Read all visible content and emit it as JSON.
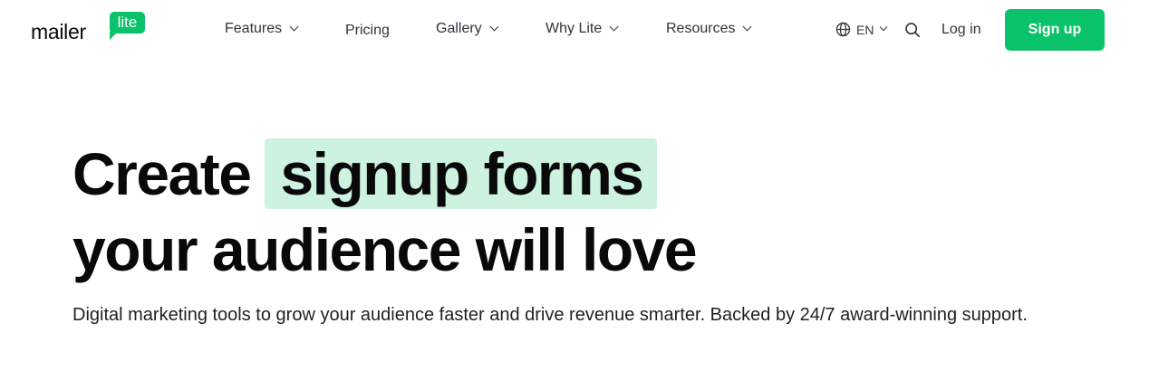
{
  "brand": {
    "word": "mailer",
    "badge": "lite",
    "accent_color": "#09c269",
    "highlight_color": "#cdf2e0"
  },
  "nav": {
    "features": "Features",
    "pricing": "Pricing",
    "gallery": "Gallery",
    "why_lite": "Why Lite",
    "resources": "Resources"
  },
  "header_actions": {
    "language": "EN",
    "language_icon": "globe-icon",
    "search_icon": "search-icon",
    "login": "Log in",
    "signup": "Sign up"
  },
  "hero": {
    "title_prefix": "Create",
    "title_highlight": "signup forms",
    "title_line2": "your audience will love",
    "subtitle": "Digital marketing tools to grow your audience faster and drive revenue smarter. Backed by 24/7 award-winning support."
  }
}
